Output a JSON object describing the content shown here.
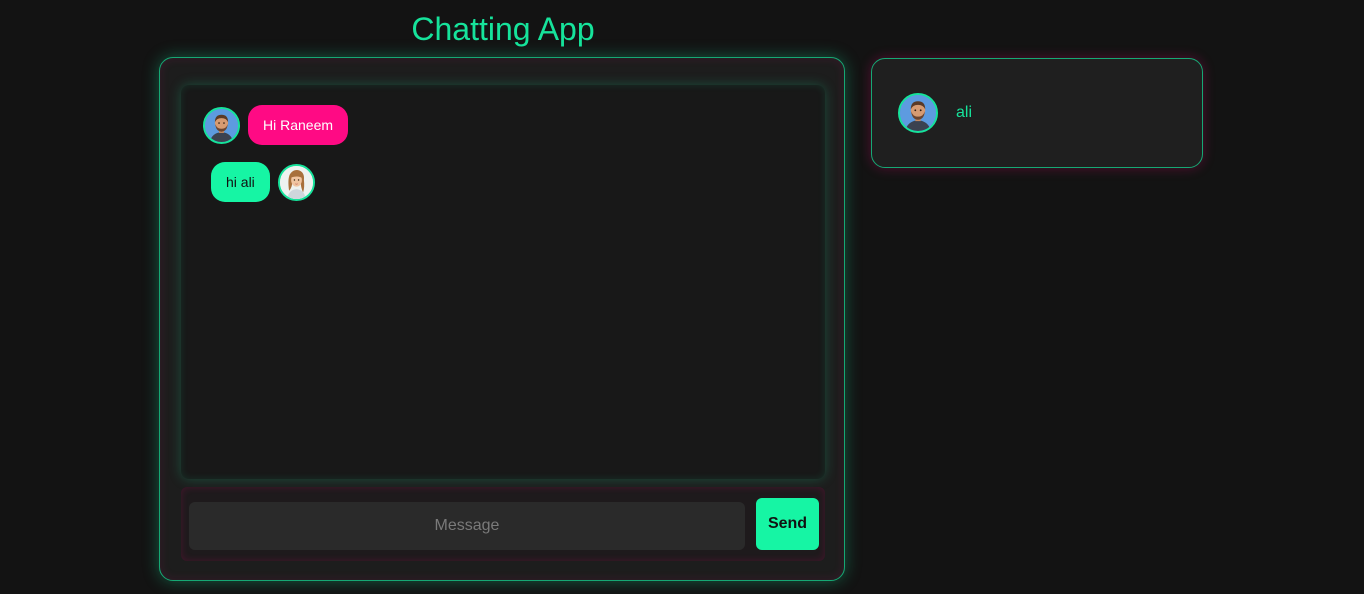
{
  "header": {
    "title": "Chatting App"
  },
  "chat": {
    "messages": [
      {
        "text": "Hi Raneem",
        "direction": "received",
        "avatar_icon": "male-avatar-icon"
      },
      {
        "text": "hi ali",
        "direction": "sent",
        "avatar_icon": "female-avatar-icon"
      }
    ],
    "composer": {
      "placeholder": "Message",
      "value": "",
      "send_label": "Send"
    }
  },
  "users": [
    {
      "name": "ali",
      "avatar_icon": "male-avatar-icon"
    }
  ],
  "colors": {
    "accent_green": "#16e39b",
    "bubble_pink": "#ff0a84",
    "bubble_green": "#16f5a4",
    "background": "#131313"
  }
}
